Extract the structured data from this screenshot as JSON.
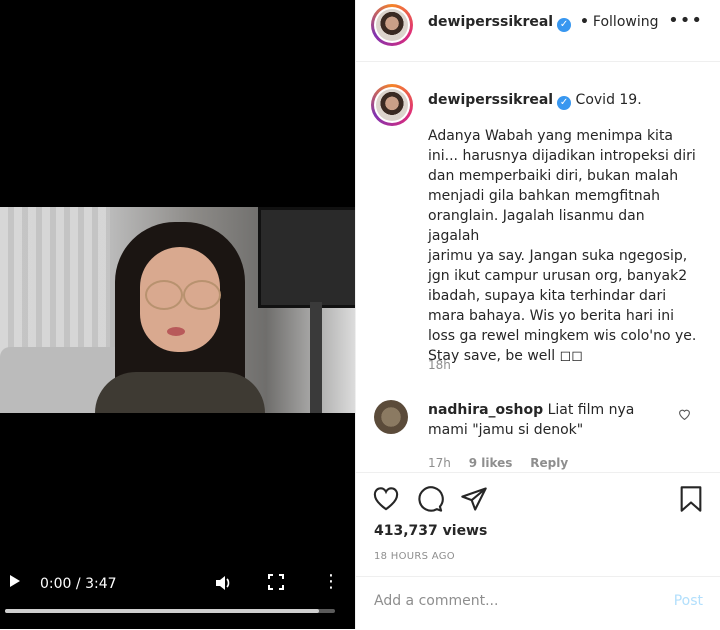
{
  "video": {
    "current_time": "0:00",
    "separator": " / ",
    "duration": "3:47",
    "progress_fraction": 0.0,
    "buffered_fraction": 0.95
  },
  "header": {
    "username": "dewiperssikreal",
    "verified_mark": "✓",
    "dot": "•",
    "follow_status": "Following",
    "more_label": "•••"
  },
  "caption": {
    "username": "dewiperssikreal",
    "title": "Covid 19.",
    "body": "Adanya Wabah yang menimpa kita\nini... harusnya dijadikan intropeksi diri\ndan memperbaiki diri, bukan malah\nmenjadi gila bahkan memgfitnah\noranglain. Jagalah lisanmu dan jagalah\njarimu ya say. Jangan suka ngegosip,\njgn ikut campur urusan org, banyak2\nibadah, supaya kita terhindar dari\nmara bahaya. Wis yo berita hari ini\nloss ga rewel mingkem wis colo'no ye.\nStay save, be well ◻◻",
    "time": "18h"
  },
  "comment": {
    "username": "nadhira_oshop",
    "text": "Liat film nya mami \"jamu si denok\"",
    "time": "17h",
    "likes": "9 likes",
    "reply": "Reply"
  },
  "actions": {
    "views": "413,737 views",
    "posted_ago": "18 HOURS AGO"
  },
  "add_comment": {
    "placeholder": "Add a comment...",
    "post_label": "Post"
  },
  "colors": {
    "verified": "#3897f0",
    "post_disabled": "#b2dffc",
    "meta_gray": "#8e8e8e"
  }
}
